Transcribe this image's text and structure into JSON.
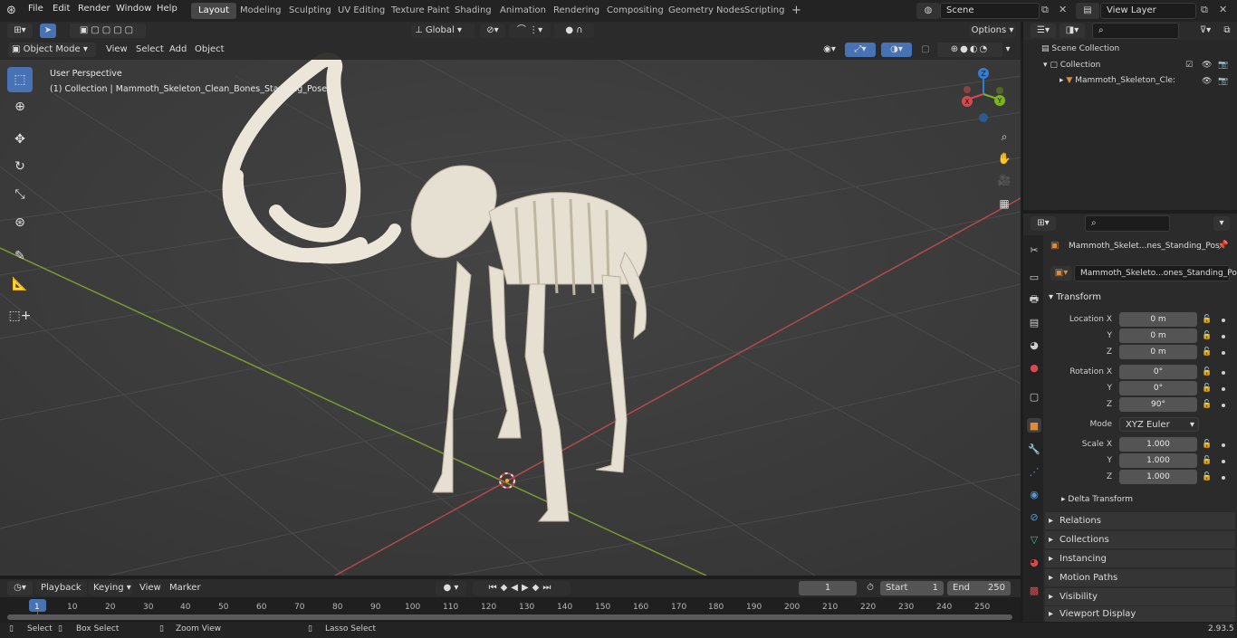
{
  "menu": {
    "file": "File",
    "edit": "Edit",
    "render": "Render",
    "window": "Window",
    "help": "Help"
  },
  "workspaces": [
    "Layout",
    "Modeling",
    "Sculpting",
    "UV Editing",
    "Texture Paint",
    "Shading",
    "Animation",
    "Rendering",
    "Compositing",
    "Geometry Nodes",
    "Scripting"
  ],
  "scene": {
    "name": "Scene",
    "view_layer": "View Layer"
  },
  "tool_header": {
    "orientation": "Global",
    "options": "Options"
  },
  "viewport_header": {
    "mode": "Object Mode",
    "view": "View",
    "select": "Select",
    "add": "Add",
    "object": "Object"
  },
  "viewport": {
    "perspective": "User Perspective",
    "collection_label": "(1) Collection | Mammoth_Skeleton_Clean_Bones_Standing_Pose"
  },
  "gizmo": {
    "x": "X",
    "y": "Y",
    "z": "Z"
  },
  "outliner": {
    "scene_collection": "Scene Collection",
    "collection": "Collection",
    "object": "Mammoth_Skeleton_Cle:"
  },
  "properties": {
    "object_name": "Mammoth_Skelet...nes_Standing_Pos",
    "object_field": "Mammoth_Skeleto...ones_Standing_Pose",
    "transform_label": "Transform",
    "location_label": "Location X",
    "y_label": "Y",
    "z_label": "Z",
    "rotation_label": "Rotation X",
    "scale_label": "Scale X",
    "mode_label": "Mode",
    "location": [
      "0 m",
      "0 m",
      "0 m"
    ],
    "rotation": [
      "0°",
      "0°",
      "90°"
    ],
    "scale": [
      "1.000",
      "1.000",
      "1.000"
    ],
    "rotation_mode": "XYZ Euler",
    "delta": "Delta Transform",
    "panels": [
      "Relations",
      "Collections",
      "Instancing",
      "Motion Paths",
      "Visibility",
      "Viewport Display"
    ]
  },
  "timeline": {
    "playback": "Playback",
    "keying": "Keying",
    "view": "View",
    "marker": "Marker",
    "current_frame": "1",
    "start_label": "Start",
    "start": "1",
    "end_label": "End",
    "end": "250",
    "ticks": [
      "1",
      "10",
      "20",
      "30",
      "40",
      "50",
      "60",
      "70",
      "80",
      "90",
      "100",
      "110",
      "120",
      "130",
      "140",
      "150",
      "160",
      "170",
      "180",
      "190",
      "200",
      "210",
      "220",
      "230",
      "240",
      "250"
    ]
  },
  "status": {
    "select": "Select",
    "box_select": "Box Select",
    "zoom_view": "Zoom View",
    "lasso_select": "Lasso Select",
    "version": "2.93.5"
  },
  "colors": {
    "accent": "#4772b3",
    "x_axis": "#d9484f",
    "y_axis": "#7bb51b",
    "z_axis": "#2f7fd8",
    "bone": "#e6e0d2"
  }
}
